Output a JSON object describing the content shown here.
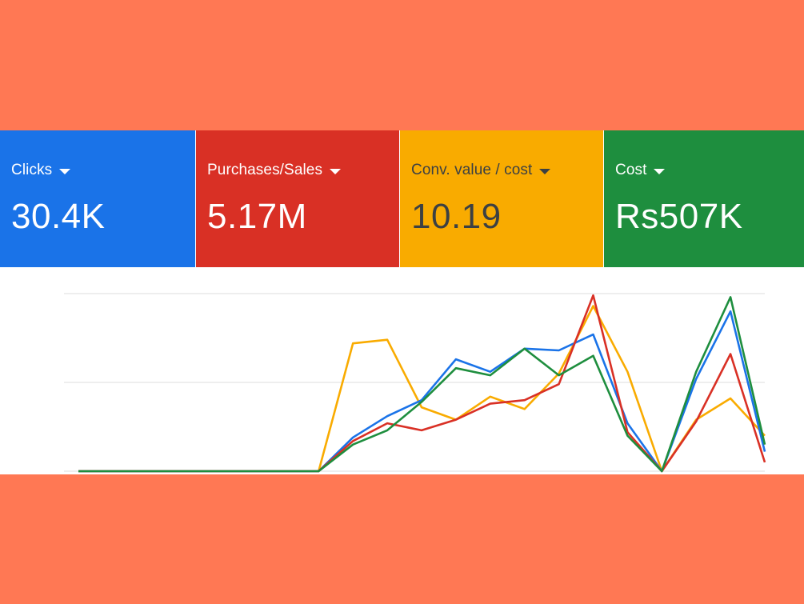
{
  "metric_cards": [
    {
      "label": "Clicks",
      "value": "30.4K",
      "color": "#1a73e8",
      "text_color": "#ffffff",
      "icon": "dropdown-arrow-icon"
    },
    {
      "label": "Purchases/Sales",
      "value": "5.17M",
      "color": "#d93025",
      "text_color": "#ffffff",
      "icon": "dropdown-arrow-icon"
    },
    {
      "label": "Conv. value / cost",
      "value": "10.19",
      "color": "#f9ab00",
      "text_color": "#3c4043",
      "icon": "dropdown-arrow-icon"
    },
    {
      "label": "Cost",
      "value": "Rs507K",
      "color": "#1e8e3e",
      "text_color": "#ffffff",
      "icon": "dropdown-arrow-icon"
    }
  ],
  "chart_data": {
    "type": "line",
    "x": [
      1,
      2,
      3,
      4,
      5,
      6,
      7,
      8,
      9,
      10,
      11,
      12,
      13,
      14,
      15,
      16,
      17,
      18,
      19,
      20,
      21,
      22,
      23,
      24
    ],
    "ylim": [
      0,
      100
    ],
    "grid": true,
    "series": [
      {
        "color": "#1a73e8",
        "values": [
          0,
          0,
          0,
          0,
          0,
          0,
          0,
          0,
          19,
          31,
          40,
          63,
          56,
          69,
          68,
          77,
          27,
          0,
          52,
          90,
          11
        ]
      },
      {
        "color": "#d93025",
        "values": [
          0,
          0,
          0,
          0,
          0,
          0,
          0,
          0,
          17,
          27,
          23,
          29,
          38,
          40,
          49,
          99,
          22,
          0,
          28,
          66,
          5
        ]
      },
      {
        "color": "#f9ab00",
        "values": [
          0,
          0,
          0,
          0,
          0,
          0,
          0,
          0,
          72,
          74,
          36,
          29,
          42,
          35,
          55,
          93,
          56,
          0,
          29,
          41,
          20
        ]
      },
      {
        "color": "#1e8e3e",
        "values": [
          0,
          0,
          0,
          0,
          0,
          0,
          0,
          0,
          15,
          23,
          39,
          58,
          54,
          69,
          54,
          65,
          20,
          0,
          56,
          98,
          15
        ]
      }
    ]
  }
}
